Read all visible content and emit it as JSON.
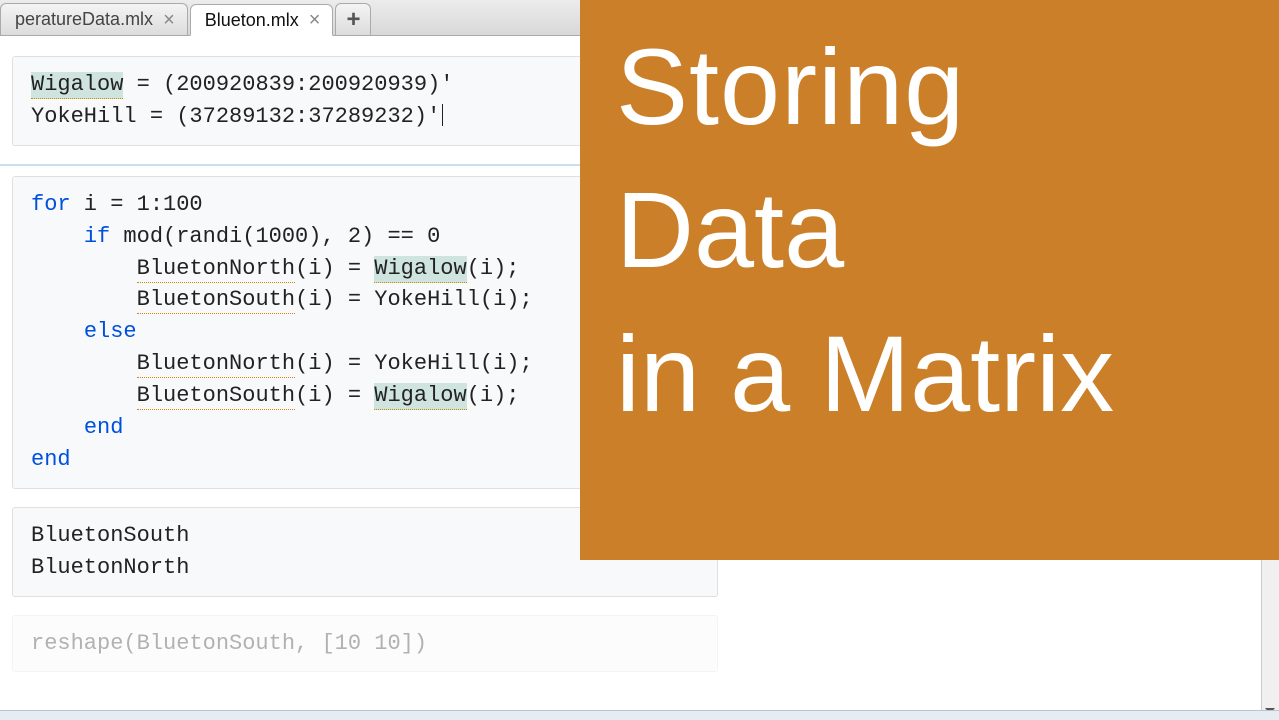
{
  "tabs": [
    {
      "label": "peratureData.mlx",
      "active": false
    },
    {
      "label": "Blueton.mlx",
      "active": true
    }
  ],
  "overlay": {
    "line1": "Storing",
    "line2": "Data",
    "line3": "in a Matrix"
  },
  "code": {
    "cell1": {
      "t_wigalow": "Wigalow",
      "t_eq1": " = (200920839:200920939)'",
      "t_yokehill": "YokeHill = (37289132:37289232)'"
    },
    "cell2": {
      "l1_kw": "for",
      "l1_rest": " i = 1:100",
      "l2_kw": "if",
      "l2_rest": " mod(randi(1000), 2) == 0",
      "l3a": "BluetonNorth",
      "l3b": "(i) = ",
      "l3c": "Wigalow",
      "l3d": "(i);",
      "l4a": "BluetonSouth",
      "l4b": "(i) = YokeHill(i);",
      "l5_kw": "else",
      "l6a": "BluetonNorth",
      "l6b": "(i) = YokeHill(i);",
      "l7a": "BluetonSouth",
      "l7b": "(i) = ",
      "l7c": "Wigalow",
      "l7d": "(i);",
      "l8_kw": "end",
      "l9_kw": "end"
    },
    "cell3": {
      "l1": "BluetonSouth",
      "l2": "BluetonNorth"
    },
    "cell4": {
      "l1": "reshape(BluetonSouth, [10 10])"
    }
  }
}
